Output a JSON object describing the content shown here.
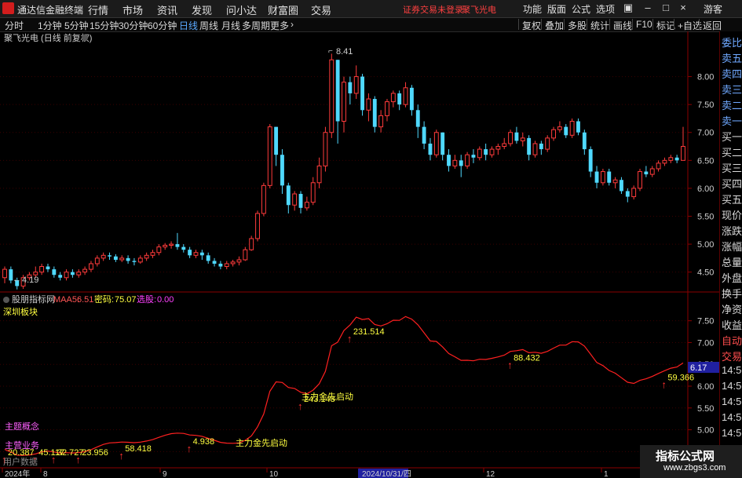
{
  "titlebar": {
    "app_name": "通达信金融终端",
    "menus": [
      "行情",
      "市场",
      "资讯",
      "发现",
      "问小达",
      "财富圈",
      "交易"
    ],
    "warning": "证券交易未登录",
    "stock_name": "聚飞光电",
    "tools": [
      "功能",
      "版面",
      "公式",
      "选项"
    ],
    "guest": "游客"
  },
  "periodbar": {
    "periods": [
      "分时",
      "1分钟",
      "5分钟",
      "15分钟",
      "30分钟",
      "60分钟",
      "日线",
      "周线",
      "月线",
      "多周期",
      "更多"
    ],
    "active": "日线",
    "right_buttons": [
      "复权",
      "叠加",
      "多股",
      "统计",
      "画线",
      "F10",
      "标记",
      "+自选",
      "返回"
    ]
  },
  "main_chart": {
    "title": "聚飞光电 (日线 前复权)",
    "high_label": "8.41",
    "low_label": "4.19",
    "y_ticks": [
      "8.00",
      "7.50",
      "7.00",
      "6.50",
      "6.00",
      "5.50",
      "5.00",
      "4.50"
    ],
    "colors": {
      "up": "#ff3b3b",
      "down": "#4fd9ff",
      "bg": "#000000",
      "grid": "#5b0000"
    }
  },
  "indicator": {
    "name": "股朋指标网",
    "maa5_label": "MAA5:",
    "maa5_value": "6.51",
    "code_label": "密码:",
    "code_value": "75.07",
    "pick_label": "选股:",
    "pick_value": "0.00",
    "board": "深圳板块",
    "concept": "主题概念",
    "business": "主营业务",
    "data_label": "用户数据",
    "current_value": "6.17",
    "y_ticks": [
      "7.50",
      "7.00",
      "6.50",
      "6.00",
      "5.50",
      "5.00",
      "4.50"
    ],
    "signals": [
      {
        "label": "20.387"
      },
      {
        "label": "45.117"
      },
      {
        "label": "32.727"
      },
      {
        "label": "23.956"
      },
      {
        "label": "58.418"
      },
      {
        "label": "4.938"
      },
      {
        "label": "243.148"
      },
      {
        "label": "231.514"
      },
      {
        "label": "88.432"
      },
      {
        "label": "59.366"
      }
    ],
    "starts": [
      "主力金先启动",
      "主力金先启动"
    ]
  },
  "xaxis": {
    "labels": [
      "2024年",
      "8",
      "9",
      "10",
      "2024/10/31/四",
      "12",
      "1"
    ]
  },
  "right_panel": {
    "labels": [
      "委比",
      "卖五",
      "卖四",
      "卖三",
      "卖二",
      "卖一",
      "买一",
      "买二",
      "买三",
      "买四",
      "买五",
      "现价",
      "涨跌",
      "涨幅",
      "总量",
      "外盘",
      "换手",
      "净资",
      "收益",
      "自动",
      "交易",
      "14:56",
      "14:56",
      "14:56",
      "14:56",
      "14:56",
      "14:56",
      "14:56"
    ]
  },
  "watermark": {
    "title": "指标公式网",
    "url": "www.zbgs3.com"
  },
  "chart_data": {
    "type": "candlestick",
    "period": "日线",
    "ylim": [
      4.2,
      8.5
    ],
    "candles": [
      [
        4.4,
        4.55,
        4.6,
        4.3
      ],
      [
        4.55,
        4.35,
        4.6,
        4.3
      ],
      [
        4.35,
        4.25,
        4.4,
        4.19
      ],
      [
        4.25,
        4.4,
        4.45,
        4.2
      ],
      [
        4.4,
        4.45,
        4.5,
        4.35
      ],
      [
        4.45,
        4.5,
        4.6,
        4.4
      ],
      [
        4.5,
        4.6,
        4.65,
        4.45
      ],
      [
        4.6,
        4.55,
        4.65,
        4.5
      ],
      [
        4.55,
        4.45,
        4.6,
        4.4
      ],
      [
        4.45,
        4.4,
        4.5,
        4.35
      ],
      [
        4.4,
        4.5,
        4.55,
        4.35
      ],
      [
        4.5,
        4.45,
        4.55,
        4.4
      ],
      [
        4.45,
        4.5,
        4.55,
        4.4
      ],
      [
        4.5,
        4.55,
        4.6,
        4.45
      ],
      [
        4.55,
        4.65,
        4.7,
        4.5
      ],
      [
        4.65,
        4.75,
        4.8,
        4.6
      ],
      [
        4.75,
        4.8,
        4.85,
        4.7
      ],
      [
        4.8,
        4.78,
        4.85,
        4.72
      ],
      [
        4.78,
        4.72,
        4.82,
        4.68
      ],
      [
        4.72,
        4.75,
        4.8,
        4.68
      ],
      [
        4.75,
        4.7,
        4.8,
        4.65
      ],
      [
        4.7,
        4.68,
        4.75,
        4.62
      ],
      [
        4.68,
        4.75,
        4.8,
        4.65
      ],
      [
        4.75,
        4.8,
        4.85,
        4.7
      ],
      [
        4.8,
        4.85,
        4.9,
        4.75
      ],
      [
        4.85,
        4.95,
        5.0,
        4.8
      ],
      [
        4.95,
        4.98,
        5.02,
        4.9
      ],
      [
        4.98,
        5.0,
        5.05,
        4.92
      ],
      [
        5.0,
        4.95,
        5.2,
        4.9
      ],
      [
        4.95,
        4.9,
        5.0,
        4.85
      ],
      [
        4.9,
        4.8,
        4.95,
        4.75
      ],
      [
        4.8,
        4.85,
        4.9,
        4.75
      ],
      [
        4.85,
        4.8,
        4.9,
        4.72
      ],
      [
        4.8,
        4.7,
        4.85,
        4.65
      ],
      [
        4.7,
        4.65,
        4.75,
        4.6
      ],
      [
        4.65,
        4.6,
        4.7,
        4.55
      ],
      [
        4.6,
        4.65,
        4.7,
        4.55
      ],
      [
        4.65,
        4.68,
        4.72,
        4.6
      ],
      [
        4.68,
        4.72,
        4.78,
        4.62
      ],
      [
        4.72,
        4.9,
        4.95,
        4.7
      ],
      [
        4.9,
        5.1,
        5.15,
        4.88
      ],
      [
        5.1,
        5.55,
        5.6,
        5.05
      ],
      [
        5.55,
        6.05,
        6.1,
        5.5
      ],
      [
        6.05,
        7.1,
        7.15,
        6.0
      ],
      [
        7.1,
        6.6,
        7.1,
        6.4
      ],
      [
        6.6,
        6.05,
        6.7,
        5.9
      ],
      [
        6.05,
        5.7,
        6.1,
        5.55
      ],
      [
        5.7,
        5.9,
        5.95,
        5.6
      ],
      [
        5.9,
        5.65,
        5.95,
        5.55
      ],
      [
        5.65,
        5.75,
        5.85,
        5.6
      ],
      [
        5.75,
        6.1,
        6.2,
        5.7
      ],
      [
        6.1,
        6.4,
        6.55,
        6.0
      ],
      [
        6.4,
        7.0,
        7.1,
        6.3
      ],
      [
        7.0,
        8.3,
        8.41,
        6.9
      ],
      [
        8.3,
        7.2,
        8.3,
        6.8
      ],
      [
        7.2,
        7.9,
        8.0,
        7.0
      ],
      [
        7.9,
        7.7,
        8.0,
        7.5
      ],
      [
        7.7,
        8.0,
        8.2,
        7.6
      ],
      [
        8.0,
        7.4,
        8.05,
        7.3
      ],
      [
        7.4,
        7.6,
        7.7,
        7.2
      ],
      [
        7.6,
        7.1,
        7.65,
        7.0
      ],
      [
        7.1,
        7.3,
        7.4,
        7.0
      ],
      [
        7.3,
        7.55,
        7.6,
        7.2
      ],
      [
        7.55,
        7.7,
        7.75,
        7.45
      ],
      [
        7.7,
        7.5,
        7.75,
        7.4
      ],
      [
        7.5,
        7.8,
        7.9,
        7.45
      ],
      [
        7.8,
        7.4,
        7.85,
        7.3
      ],
      [
        7.4,
        7.1,
        7.5,
        6.9
      ],
      [
        7.1,
        6.8,
        7.2,
        6.7
      ],
      [
        6.8,
        6.6,
        6.9,
        6.5
      ],
      [
        6.6,
        7.0,
        7.05,
        6.55
      ],
      [
        7.0,
        6.6,
        7.0,
        6.5
      ],
      [
        6.6,
        6.4,
        6.7,
        6.3
      ],
      [
        6.4,
        6.5,
        6.6,
        6.35
      ],
      [
        6.5,
        6.4,
        6.6,
        6.2
      ],
      [
        6.4,
        6.6,
        6.65,
        6.35
      ],
      [
        6.6,
        6.55,
        6.7,
        6.45
      ],
      [
        6.55,
        6.7,
        6.75,
        6.5
      ],
      [
        6.7,
        6.6,
        6.8,
        6.5
      ],
      [
        6.6,
        6.7,
        6.75,
        6.55
      ],
      [
        6.7,
        6.75,
        6.8,
        6.6
      ],
      [
        6.75,
        6.8,
        6.9,
        6.7
      ],
      [
        6.8,
        7.0,
        7.05,
        6.75
      ],
      [
        7.0,
        6.85,
        7.1,
        6.8
      ],
      [
        6.85,
        6.9,
        7.0,
        6.75
      ],
      [
        6.9,
        6.6,
        6.95,
        6.5
      ],
      [
        6.6,
        6.8,
        6.85,
        6.55
      ],
      [
        6.8,
        6.7,
        6.85,
        6.6
      ],
      [
        6.7,
        6.9,
        6.95,
        6.65
      ],
      [
        6.9,
        7.05,
        7.1,
        6.85
      ],
      [
        7.05,
        7.1,
        7.2,
        7.0
      ],
      [
        7.1,
        6.95,
        7.15,
        6.9
      ],
      [
        6.95,
        7.2,
        7.25,
        6.9
      ],
      [
        7.2,
        7.0,
        7.25,
        6.95
      ],
      [
        7.0,
        6.7,
        7.05,
        6.6
      ],
      [
        6.7,
        6.3,
        6.75,
        6.2
      ],
      [
        6.3,
        6.1,
        6.4,
        6.0
      ],
      [
        6.1,
        6.3,
        6.35,
        6.05
      ],
      [
        6.3,
        6.1,
        6.35,
        6.05
      ],
      [
        6.1,
        6.15,
        6.2,
        6.0
      ],
      [
        6.15,
        5.95,
        6.2,
        5.9
      ],
      [
        5.95,
        5.85,
        6.0,
        5.75
      ],
      [
        5.85,
        6.0,
        6.05,
        5.8
      ],
      [
        6.0,
        6.3,
        6.35,
        5.95
      ],
      [
        6.3,
        6.25,
        6.4,
        6.2
      ],
      [
        6.25,
        6.35,
        6.4,
        6.2
      ],
      [
        6.35,
        6.45,
        6.5,
        6.3
      ],
      [
        6.45,
        6.5,
        6.55,
        6.4
      ],
      [
        6.5,
        6.55,
        6.6,
        6.45
      ],
      [
        6.55,
        6.5,
        6.6,
        6.45
      ],
      [
        6.5,
        6.75,
        7.1,
        6.5
      ]
    ]
  }
}
